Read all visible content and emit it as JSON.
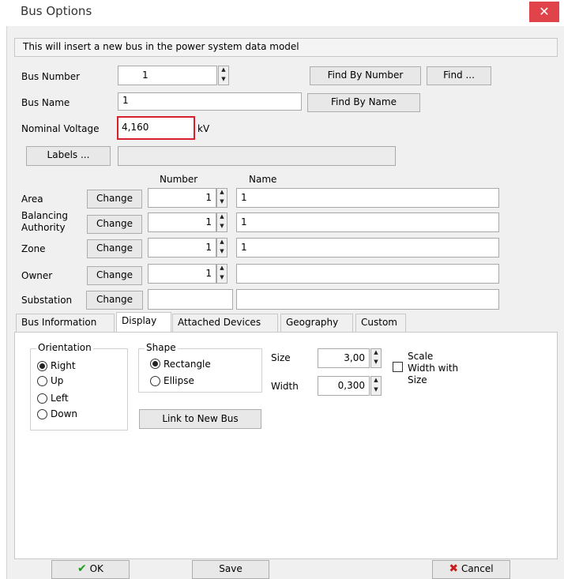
{
  "window": {
    "title": "Bus Options",
    "close_glyph": "✕"
  },
  "info_text": "This will insert a new bus in the power system data model",
  "bus_number": {
    "label": "Bus Number",
    "value": "1",
    "find_by_number": "Find By Number",
    "find": "Find ..."
  },
  "bus_name": {
    "label": "Bus Name",
    "value": "1",
    "find_by_name": "Find By Name"
  },
  "nominal_voltage": {
    "label": "Nominal Voltage",
    "value": "4,160",
    "unit": "kV"
  },
  "labels": {
    "button": "Labels ...",
    "value": ""
  },
  "headers": {
    "number": "Number",
    "name": "Name"
  },
  "rows": [
    {
      "label": "Area",
      "button": "Change",
      "number": "1",
      "name": "1"
    },
    {
      "label": "Balancing Authority",
      "button": "Change",
      "number": "1",
      "name": "1"
    },
    {
      "label": "Zone",
      "button": "Change",
      "number": "1",
      "name": "1"
    },
    {
      "label": "Owner",
      "button": "Change",
      "number": "1",
      "name": ""
    },
    {
      "label": "Substation",
      "button": "Change",
      "number": "",
      "name": ""
    }
  ],
  "tabs": [
    "Bus Information",
    "Display",
    "Attached Devices",
    "Geography",
    "Custom"
  ],
  "active_tab": "Display",
  "orientation": {
    "title": "Orientation",
    "options": [
      "Right",
      "Up",
      "Left",
      "Down"
    ],
    "selected": "Right"
  },
  "shape": {
    "title": "Shape",
    "options": [
      "Rectangle",
      "Ellipse"
    ],
    "selected": "Rectangle"
  },
  "size": {
    "label": "Size",
    "value": "3,00"
  },
  "width": {
    "label": "Width",
    "value": "0,300"
  },
  "scale": {
    "label": "Scale Width with Size",
    "checked": false
  },
  "link_button": "Link to New Bus",
  "footer": {
    "ok": "OK",
    "save": "Save",
    "cancel": "Cancel"
  },
  "colors": {
    "accent_close": "#e0434a",
    "highlight": "#d6202b",
    "ok_check": "#1e9a1e",
    "cancel_x": "#c81e1e"
  }
}
